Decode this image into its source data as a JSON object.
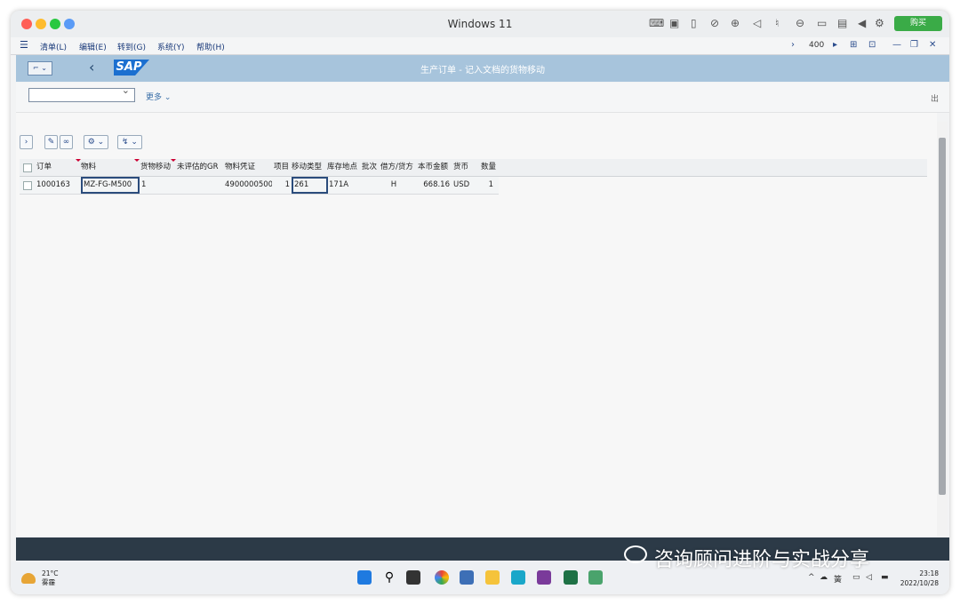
{
  "window": {
    "title": "Windows 11",
    "buy_label": "购买"
  },
  "menu": {
    "items": [
      "清单(L)",
      "编辑(E)",
      "转到(G)",
      "系统(Y)",
      "帮助(H)"
    ],
    "client": "400"
  },
  "header": {
    "title": "生产订单 - 记入文档的货物移动",
    "logo": "SAP"
  },
  "filter": {
    "more_label": "更多",
    "exit_label": "出"
  },
  "table": {
    "columns": [
      "订单",
      "物料",
      "货物移动",
      "未评估的GR",
      "物料凭证",
      "项目",
      "移动类型",
      "库存地点",
      "批次",
      "借方/贷方",
      "本币金额",
      "货币",
      "数量"
    ],
    "rows": [
      {
        "order": "1000163",
        "material": "MZ-FG-M500",
        "goods_movement": "1",
        "unvaluated_gr": "",
        "material_document": "4900000500",
        "item": "1",
        "movement_type": "261",
        "storage_location": "171A",
        "batch": "",
        "debit_credit": "H",
        "amount": "668.16",
        "currency": "USD",
        "quantity": "1"
      }
    ]
  },
  "taskbar": {
    "temperature": "21°C",
    "weather": "雾霾",
    "time": "23:18",
    "date": "2022/10/28",
    "ime": "簧"
  },
  "watermark": "咨询顾问进阶与实战分享",
  "colors": {
    "sap_header": "#a7c4dc",
    "sap_logo": "#1b6fd0",
    "buy_button": "#3aab47",
    "dark_bar": "#2c3a47"
  }
}
